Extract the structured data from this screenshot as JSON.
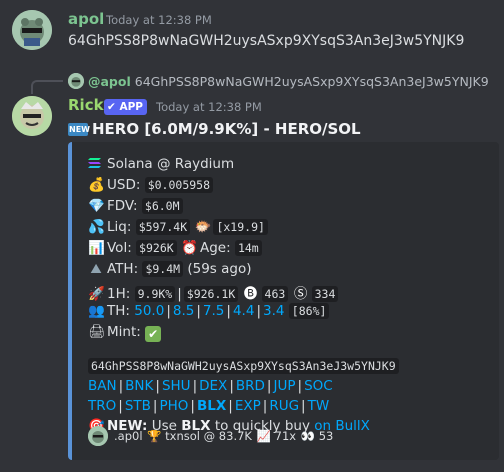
{
  "message1": {
    "username": "apol",
    "timestamp": "Today at 12:38 PM",
    "content": "64GhPSS8P8wNaGWH2uysASxp9XYsqS3An3eJ3w5YNJK9"
  },
  "reply": {
    "user": "@apol",
    "content": "64GhPSS8P8wNaGWH2uysASxp9XYsqS3An3eJ3w5YNJK9"
  },
  "message2": {
    "username": "Rick",
    "badge": "APP",
    "timestamp": "Today at 12:38 PM",
    "title": "HERO [6.0M/9.9K%] - HERO/SOL",
    "new_badge": "NEW"
  },
  "embed": {
    "accent_color": "#5a93d8",
    "pair": "Solana @ Raydium",
    "usd_label": "USD:",
    "usd_value": "$0.005958",
    "fdv_label": "FDV:",
    "fdv_value": "$6.0M",
    "liq_label": "Liq:",
    "liq_value": "$597.4K",
    "liq_mult": "[x19.9]",
    "vol_label": "Vol:",
    "vol_value": "$926K",
    "age_label": "Age:",
    "age_value": "14m",
    "ath_label": "ATH:",
    "ath_value": "$9.4M",
    "ath_ago": "(59s ago)",
    "h1_label": "1H:",
    "h1_pct": "9.9K%",
    "h1_vol": "$926.1K",
    "h1_buys": "463",
    "h1_sells": "334",
    "th_label": "TH:",
    "th_values": [
      "50.0",
      "8.5",
      "7.5",
      "4.4",
      "3.4"
    ],
    "th_total": "[86%]",
    "mint_label": "Mint:",
    "contract": "64GhPSS8P8wNaGWH2uysASxp9XYsqS3An3eJ3w5YNJK9",
    "links_row1": [
      "BAN",
      "BNK",
      "SHU",
      "DEX",
      "BRD",
      "JUP",
      "SOC"
    ],
    "links_row2": [
      "TRO",
      "STB",
      "PHO",
      "BLX",
      "EXP",
      "RUG",
      "TW"
    ],
    "new_label": "NEW:",
    "new_text_pre": "Use",
    "new_text_bold": "BLX",
    "new_text_post": "to quickly buy",
    "new_link": "on BullX",
    "footer": {
      "user": ".ap0l",
      "trophy_user": "txnsol @ 83.7K",
      "mult": "71x",
      "eyes_count": "53"
    }
  }
}
